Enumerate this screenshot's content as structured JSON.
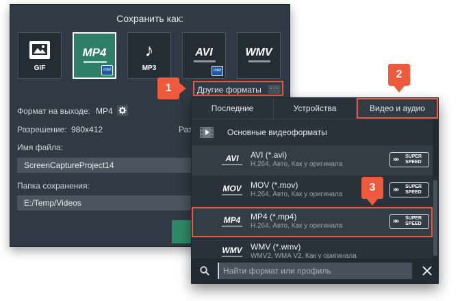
{
  "dialog": {
    "title": "Сохранить как:",
    "formats": [
      {
        "id": "gif",
        "label": "GIF"
      },
      {
        "id": "mp4",
        "label": "MP4",
        "selected": true
      },
      {
        "id": "mp3",
        "label": "MP3"
      },
      {
        "id": "avi",
        "label": "AVI"
      },
      {
        "id": "wmv",
        "label": "WMV"
      }
    ],
    "output_format_label": "Формат на выходе:",
    "output_format_value": "MP4",
    "resolution_label": "Разрешение:",
    "resolution_value": "980x412",
    "resolution_label_cut": "Раз",
    "filename_label": "Имя файла:",
    "filename_value": "ScreenCaptureProject14",
    "folder_label": "Папка сохранения:",
    "folder_value": "E:/Temp/Videos"
  },
  "other_formats": {
    "label": "Другие форматы",
    "dots": "···"
  },
  "panel": {
    "tabs": [
      {
        "label": "Последние"
      },
      {
        "label": "Устройства"
      },
      {
        "label": "Видео и аудио",
        "active": true
      }
    ],
    "group_label": "Основные видеоформаты",
    "rows": [
      {
        "logo": "AVI",
        "name": "AVI (*.avi)",
        "desc": "H.264, Авто, Как у оригинала",
        "super_speed": true
      },
      {
        "logo": "MOV",
        "name": "MOV (*.mov)",
        "desc": "H.264, Авто, Как у оригинала",
        "super_speed": true
      },
      {
        "logo": "MP4",
        "name": "MP4 (*.mp4)",
        "desc": "H.264, Авто, Как у оригинала",
        "super_speed": true,
        "highlighted": true
      },
      {
        "logo": "WMV",
        "name": "WMV (*.wmv)",
        "desc": "WMV2, WMA V2, Как у оригинала",
        "super_speed": false
      }
    ],
    "super_speed_line1": "SUPER",
    "super_speed_line2": "SPEED",
    "search_placeholder": "Найти формат или профиль"
  },
  "steps": [
    "1",
    "2",
    "3"
  ],
  "colors": {
    "accent": "#ef5a3c",
    "selected_tile": "#2f7f66",
    "dialog_bg": "#2f3a44"
  },
  "icons": [
    "gif-image-icon",
    "music-note-icon",
    "intel-badge-icon",
    "gear-icon",
    "film-icon",
    "search-icon",
    "close-icon",
    "super-speed-icon"
  ]
}
